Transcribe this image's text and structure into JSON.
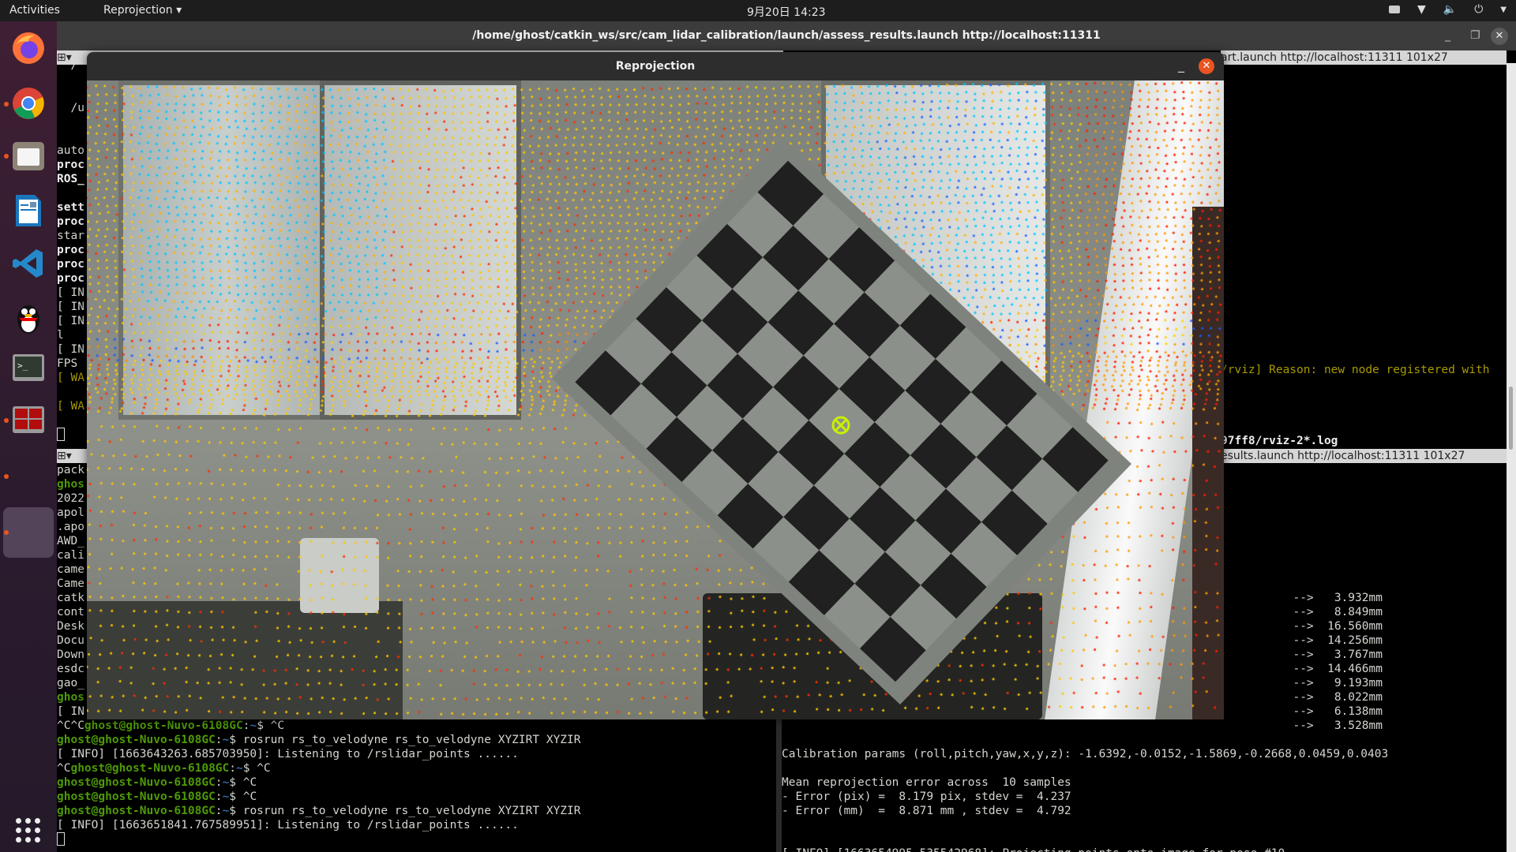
{
  "topbar": {
    "activities": "Activities",
    "app_menu": "Reprojection ▾",
    "clock": "9月20日 14:23",
    "status_icons": [
      "keyboard-icon",
      "wifi-icon",
      "volume-icon",
      "power-icon",
      "chevron-down-icon"
    ]
  },
  "dock": {
    "apps": [
      "firefox",
      "chrome",
      "files",
      "libreoffice-writer",
      "vscode",
      "qq",
      "terminal",
      "terminator"
    ]
  },
  "terminal_window": {
    "title": "/home/ghost/catkin_ws/src/cam_lidar_calibration/launch/assess_results.launch http://localhost:11311",
    "pane_headers": [
      "art.launch http://localhost:11311 101x27",
      "esults.launch http://localhost:11311 101x27"
    ]
  },
  "top_left_lines": [
    [
      {
        "t": "  /"
      }
    ],
    [
      {
        "t": ""
      }
    ],
    [
      {
        "t": ""
      }
    ],
    [
      {
        "t": "  /u"
      }
    ],
    [
      {
        "t": ""
      }
    ],
    [
      {
        "t": ""
      }
    ],
    [
      {
        "t": "auto"
      }
    ],
    [
      {
        "t": "proc",
        "s": "bold"
      }
    ],
    [
      {
        "t": "ROS_",
        "s": "bold"
      }
    ],
    [
      {
        "t": ""
      }
    ],
    [
      {
        "t": "sett",
        "s": "bold"
      }
    ],
    [
      {
        "t": "proc",
        "s": "bold"
      }
    ],
    [
      {
        "t": "star"
      }
    ],
    [
      {
        "t": "proc",
        "s": "bold"
      }
    ],
    [
      {
        "t": "proc",
        "s": "bold"
      }
    ],
    [
      {
        "t": "proc",
        "s": "bold"
      }
    ],
    [
      {
        "t": "[ IN"
      }
    ],
    [
      {
        "t": "[ IN"
      }
    ],
    [
      {
        "t": "[ IN"
      }
    ],
    [
      {
        "t": "l"
      }
    ],
    [
      {
        "t": "[ IN"
      }
    ],
    [
      {
        "t": "FPS"
      }
    ],
    [
      {
        "t": "[ WA",
        "s": "warn"
      }
    ],
    [
      {
        "t": ""
      }
    ],
    [
      {
        "t": "[ WA",
        "s": "warn"
      }
    ]
  ],
  "top_right_lines": [
    "/rviz] Reason: new node registered with",
    "97ff8/rviz-2*.log"
  ],
  "bottom_left_lines": [
    [
      {
        "t": "pack"
      }
    ],
    [
      {
        "t": "ghos",
        "s": "user"
      }
    ],
    [
      {
        "t": "2022"
      }
    ],
    [
      {
        "t": "apol"
      }
    ],
    [
      {
        "t": ".apo"
      }
    ],
    [
      {
        "t": "AWD_"
      }
    ],
    [
      {
        "t": "cali"
      }
    ],
    [
      {
        "t": "came"
      }
    ],
    [
      {
        "t": "Came"
      }
    ],
    [
      {
        "t": "catk"
      }
    ],
    [
      {
        "t": "cont"
      }
    ],
    [
      {
        "t": "Desk"
      }
    ],
    [
      {
        "t": "Docu"
      }
    ],
    [
      {
        "t": "Down"
      }
    ],
    [
      {
        "t": "esdc"
      }
    ],
    [
      {
        "t": "gao_"
      }
    ],
    [
      {
        "t": "ghos",
        "s": "user"
      }
    ],
    [
      {
        "t": "[ IN"
      }
    ],
    [
      {
        "t": "^C^C"
      },
      {
        "t": "ghost@ghost-Nuvo-6108GC",
        "s": "user"
      },
      {
        "t": ":"
      },
      {
        "t": "~",
        "s": "path"
      },
      {
        "t": "$ ^C"
      }
    ],
    [
      {
        "t": "ghost@ghost-Nuvo-6108GC",
        "s": "user"
      },
      {
        "t": ":"
      },
      {
        "t": "~",
        "s": "path"
      },
      {
        "t": "$ rosrun rs_to_velodyne rs_to_velodyne XYZIRT XYZIR"
      }
    ],
    [
      {
        "t": "[ INFO] [1663643263.685703950]: Listening to /rslidar_points ......"
      }
    ],
    [
      {
        "t": "^C"
      },
      {
        "t": "ghost@ghost-Nuvo-6108GC",
        "s": "user"
      },
      {
        "t": ":"
      },
      {
        "t": "~",
        "s": "path"
      },
      {
        "t": "$ ^C"
      }
    ],
    [
      {
        "t": "ghost@ghost-Nuvo-6108GC",
        "s": "user"
      },
      {
        "t": ":"
      },
      {
        "t": "~",
        "s": "path"
      },
      {
        "t": "$ ^C"
      }
    ],
    [
      {
        "t": "ghost@ghost-Nuvo-6108GC",
        "s": "user"
      },
      {
        "t": ":"
      },
      {
        "t": "~",
        "s": "path"
      },
      {
        "t": "$ ^C"
      }
    ],
    [
      {
        "t": "ghost@ghost-Nuvo-6108GC",
        "s": "user"
      },
      {
        "t": ":"
      },
      {
        "t": "~",
        "s": "path"
      },
      {
        "t": "$ rosrun rs_to_velodyne rs_to_velodyne XYZIRT XYZIR"
      }
    ],
    [
      {
        "t": "[ INFO] [1663651841.767589951]: Listening to /rslidar_points ......"
      }
    ]
  ],
  "sample_errors": [
    "  -->   3.932mm",
    "  -->   8.849mm",
    "  -->  16.560mm",
    "  -->  14.256mm",
    "  -->   3.767mm",
    "  -->  14.466mm",
    "  -->   9.193mm",
    "  -->   8.022mm",
    "  -->   6.138mm",
    "  -->   3.528mm"
  ],
  "results": {
    "params": "Calibration params (roll,pitch,yaw,x,y,z): -1.6392,-0.0152,-1.5869,-0.2668,0.0459,0.0403",
    "mean": "Mean reprojection error across  10 samples",
    "err_pix": "- Error (pix) =  8.179 pix, stdev =  4.237",
    "err_mm": "- Error (mm)  =  8.871 mm , stdev =  4.792",
    "info": "[ INFO] [1663654995.535542968]: Projecting points onto image for pose #10"
  },
  "reprojection_window": {
    "title": "Reprojection",
    "minimize": "_",
    "close": "✕"
  },
  "window_controls": {
    "minimize": "_",
    "maximize": "❐",
    "close": "✕"
  }
}
